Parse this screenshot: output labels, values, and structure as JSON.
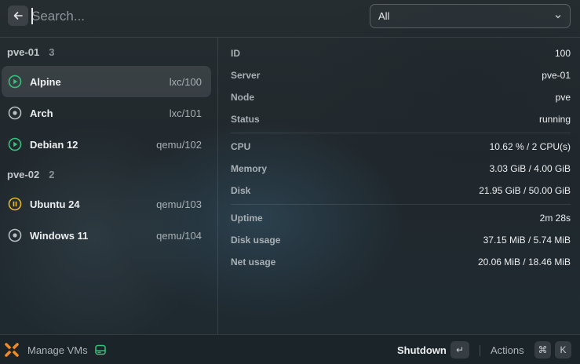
{
  "search": {
    "placeholder": "Search..."
  },
  "filter": {
    "selected": "All"
  },
  "groups": [
    {
      "name": "pve-01",
      "count": "3",
      "items": [
        {
          "name": "Alpine",
          "id": "lxc/100",
          "status_icon": "play-circle-icon",
          "status_color": "#34c37a",
          "selected": true
        },
        {
          "name": "Arch",
          "id": "lxc/101",
          "status_icon": "stopped-circle-icon",
          "status_color": "#b8bec2",
          "selected": false
        },
        {
          "name": "Debian 12",
          "id": "qemu/102",
          "status_icon": "play-circle-icon",
          "status_color": "#34c37a",
          "selected": false
        }
      ]
    },
    {
      "name": "pve-02",
      "count": "2",
      "items": [
        {
          "name": "Ubuntu 24",
          "id": "qemu/103",
          "status_icon": "pause-circle-icon",
          "status_color": "#e9b52a",
          "selected": false
        },
        {
          "name": "Windows 11",
          "id": "qemu/104",
          "status_icon": "stopped-circle-icon",
          "status_color": "#b8bec2",
          "selected": false
        }
      ]
    }
  ],
  "details": {
    "sections": [
      [
        {
          "label": "ID",
          "value": "100"
        },
        {
          "label": "Server",
          "value": "pve-01"
        },
        {
          "label": "Node",
          "value": "pve"
        },
        {
          "label": "Status",
          "value": "running"
        }
      ],
      [
        {
          "label": "CPU",
          "value": "10.62 % / 2 CPU(s)"
        },
        {
          "label": "Memory",
          "value": "3.03 GiB / 4.00 GiB"
        },
        {
          "label": "Disk",
          "value": "21.95 GiB / 50.00 GiB"
        }
      ],
      [
        {
          "label": "Uptime",
          "value": "2m 28s"
        },
        {
          "label": "Disk usage",
          "value": "37.15 MiB / 5.74 MiB"
        },
        {
          "label": "Net usage",
          "value": "20.06 MiB / 18.46 MiB"
        }
      ]
    ]
  },
  "footer": {
    "title": "Manage VMs",
    "primary_action": "Shutdown",
    "primary_key": "↵",
    "actions_label": "Actions",
    "actions_keys": [
      "⌘",
      "K"
    ]
  },
  "colors": {
    "accent_green": "#34c37a",
    "accent_orange": "#f08a24"
  }
}
